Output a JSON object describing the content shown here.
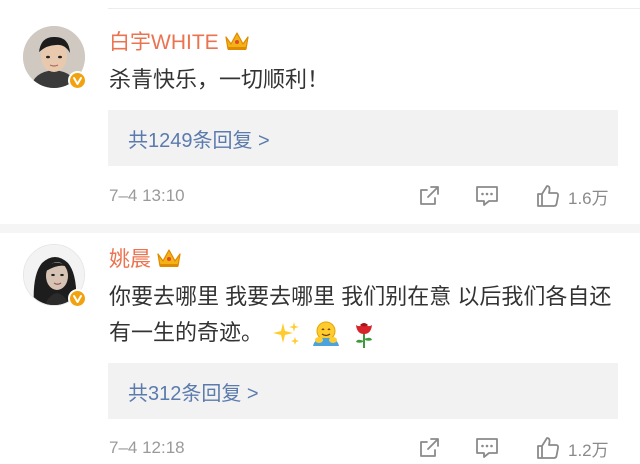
{
  "comments": [
    {
      "author": "白宇WHITE",
      "text": "杀青快乐，一切顺利！",
      "reply_label": "共1249条回复 >",
      "time": "7–4 13:10",
      "likes": "1.6万",
      "avatar_icon": "avatar-man-icon"
    },
    {
      "author": "姚晨",
      "text": "你要去哪里 我要去哪里 我们别在意 以后我们各自还有一生的奇迹。",
      "emojis": [
        "sparkles-icon",
        "hug-face-icon",
        "rose-icon"
      ],
      "reply_label": "共312条回复 >",
      "time": "7–4 12:18",
      "likes": "1.2万",
      "avatar_icon": "avatar-woman-icon"
    }
  ],
  "colors": {
    "name": "#eb7350",
    "reply_link": "#5b7bad",
    "meta": "#9a9a9a",
    "badge": "#f3a20f"
  }
}
